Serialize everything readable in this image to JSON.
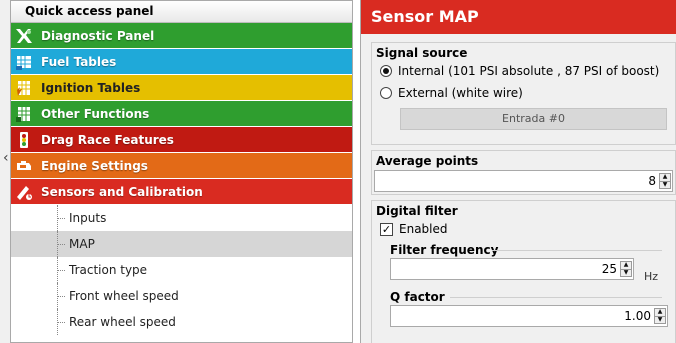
{
  "quick_access": {
    "title": "Quick access panel",
    "categories": [
      {
        "label": "Diagnostic Panel",
        "color": "#2f9e2f",
        "icon": "diagnostic-icon"
      },
      {
        "label": "Fuel Tables",
        "color": "#1fa9d9",
        "icon": "fuel-icon"
      },
      {
        "label": "Ignition Tables",
        "color": "#e5bf00",
        "icon": "ignition-icon"
      },
      {
        "label": "Other Functions",
        "color": "#2f9e2f",
        "icon": "other-functions-icon"
      },
      {
        "label": "Drag Race Features",
        "color": "#c01a12",
        "icon": "drag-race-icon"
      },
      {
        "label": "Engine Settings",
        "color": "#e36a17",
        "icon": "engine-icon"
      },
      {
        "label": "Sensors and Calibration",
        "color": "#d92b21",
        "icon": "sensor-icon"
      }
    ],
    "sub_items": [
      "Inputs",
      "MAP",
      "Traction type",
      "Front wheel speed",
      "Rear wheel speed"
    ],
    "selected_sub": "MAP"
  },
  "sensor": {
    "title": "Sensor MAP",
    "header_color": "#d92b21",
    "signal_source": {
      "title": "Signal source",
      "internal_label": "Internal (101 PSI absolute , 87 PSI of boost)",
      "external_label": "External (white wire)",
      "selected": "internal",
      "button_label": "Entrada #0"
    },
    "average_points": {
      "title": "Average points",
      "value": "8"
    },
    "digital_filter": {
      "title": "Digital filter",
      "enabled_label": "Enabled",
      "enabled": true,
      "filter_frequency": {
        "title": "Filter frequency",
        "value": "25",
        "unit": "Hz"
      },
      "q_factor": {
        "title": "Q factor",
        "value": "1.00"
      }
    }
  }
}
